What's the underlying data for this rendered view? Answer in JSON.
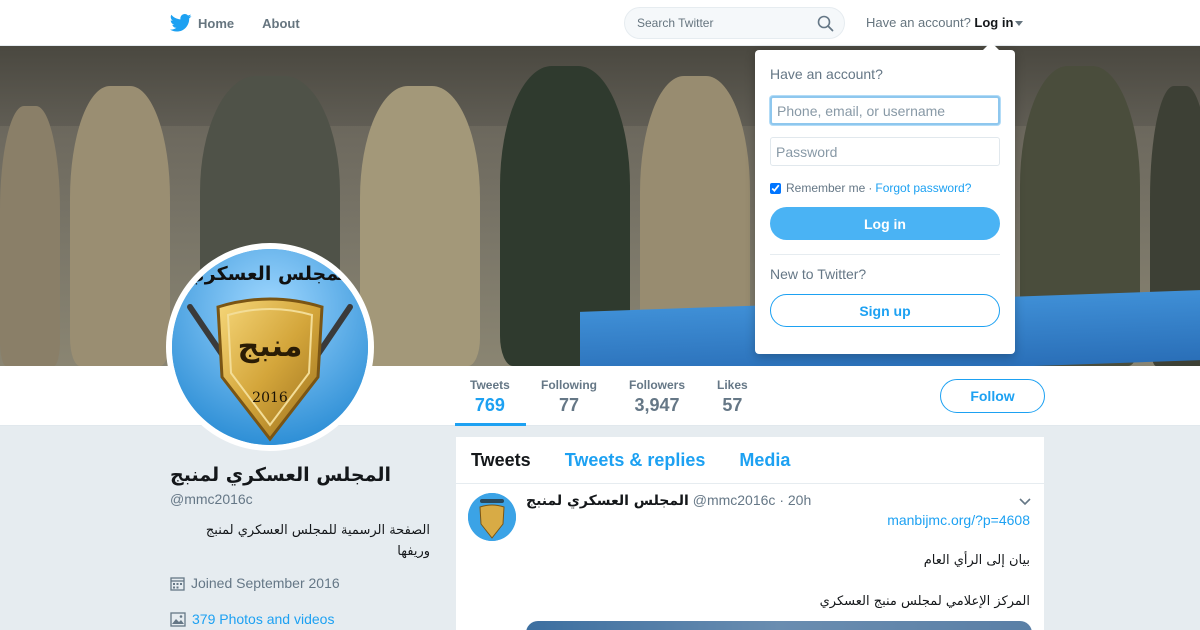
{
  "colors": {
    "brand_blue": "#1da1f2",
    "text_secondary": "#657786",
    "background": "#e6ecf0",
    "login_button": "#4ab3f4"
  },
  "topnav": {
    "logo_icon": "twitter-bird-icon",
    "home_label": "Home",
    "about_label": "About",
    "search_placeholder": "Search Twitter",
    "search_icon": "magnifier-icon",
    "have_account_text": "Have an account?",
    "login_label": "Log in"
  },
  "login_dropdown": {
    "title": "Have an account?",
    "username_placeholder": "Phone, email, or username",
    "password_placeholder": "Password",
    "remember_me_label": "Remember me",
    "remember_me_checked": true,
    "separator": "·",
    "forgot_password_label": "Forgot password?",
    "login_button": "Log in",
    "new_to_twitter": "New to Twitter?",
    "signup_button": "Sign up"
  },
  "profile": {
    "display_name": "المجلس العسكري لمنبج",
    "handle": "@mmc2016c",
    "bio": "الصفحة الرسمية للمجلس العسكري لمنبج وريفها",
    "joined": "Joined September 2016",
    "photos_videos": "379 Photos and videos",
    "avatar": {
      "top_text": "المجلس العسكري",
      "center_text": "منبج",
      "year": "2016"
    }
  },
  "stats": [
    {
      "label": "Tweets",
      "value": "769",
      "active": true
    },
    {
      "label": "Following",
      "value": "77",
      "active": false
    },
    {
      "label": "Followers",
      "value": "3,947",
      "active": false
    },
    {
      "label": "Likes",
      "value": "57",
      "active": false
    }
  ],
  "follow_button": "Follow",
  "timeline": {
    "tabs": [
      "Tweets",
      "Tweets & replies",
      "Media"
    ],
    "active_tab": 0,
    "tweet": {
      "name": "المجلس العسكري لمنبج",
      "handle": "@mmc2016c",
      "separator": "·",
      "time": "20h",
      "link": "manbijmc.org/?p=4608",
      "line1": "بيان إلى الرأي العام",
      "line2": "المركز الإعلامي لمجلس منبج العسكري"
    }
  }
}
